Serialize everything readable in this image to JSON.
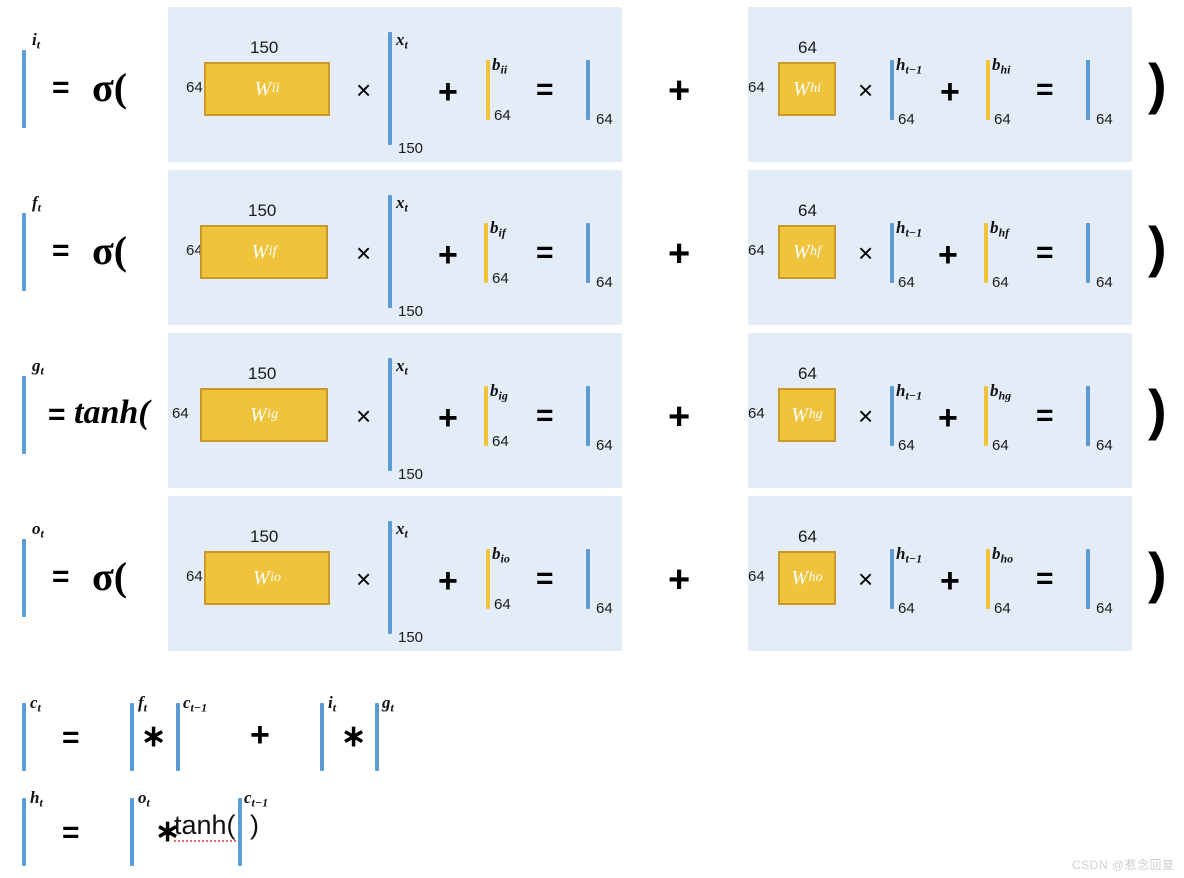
{
  "diagram": {
    "title": "LSTM gate equations with tensor shapes",
    "colors": {
      "panel_bg": "#e3ecf7",
      "weight_box_fill": "#f0c33c",
      "weight_box_border": "#c9992a",
      "vector_blue": "#5b9bd5",
      "bias_yellow": "#f2c238",
      "text": "#111111"
    }
  },
  "gate_rows": [
    {
      "output_var": "i",
      "output_sub": "t",
      "activation": "σ(",
      "activation_kind": "sigma",
      "input_dim_left": "64",
      "input_dim_top": "150",
      "weight_input": "W",
      "weight_input_sub": "ii",
      "vector_input": "x",
      "vector_input_sub": "t",
      "vector_input_dim": "150",
      "bias_input": "b",
      "bias_input_sub": "ii",
      "bias_input_dim": "64",
      "result_left_dim": "64",
      "hidden_dim_left": "64",
      "hidden_dim_top": "64",
      "weight_hidden": "W",
      "weight_hidden_sub": "hi",
      "vector_hidden": "h",
      "vector_hidden_sub": "t−1",
      "vector_hidden_dim": "64",
      "bias_hidden": "b",
      "bias_hidden_sub": "hi",
      "bias_hidden_dim": "64",
      "result_right_dim": "64"
    },
    {
      "output_var": "f",
      "output_sub": "t",
      "activation": "σ(",
      "activation_kind": "sigma",
      "input_dim_left": "64",
      "input_dim_top": "150",
      "weight_input": "W",
      "weight_input_sub": "if",
      "vector_input": "x",
      "vector_input_sub": "t",
      "vector_input_dim": "150",
      "bias_input": "b",
      "bias_input_sub": "if",
      "bias_input_dim": "64",
      "result_left_dim": "64",
      "hidden_dim_left": "64",
      "hidden_dim_top": "64",
      "weight_hidden": "W",
      "weight_hidden_sub": "hf",
      "vector_hidden": "h",
      "vector_hidden_sub": "t−1",
      "vector_hidden_dim": "64",
      "bias_hidden": "b",
      "bias_hidden_sub": "hf",
      "bias_hidden_dim": "64",
      "result_right_dim": "64"
    },
    {
      "output_var": "g",
      "output_sub": "t",
      "activation": "tanh(",
      "activation_kind": "tanh",
      "input_dim_left": "64",
      "input_dim_top": "150",
      "weight_input": "W",
      "weight_input_sub": "ig",
      "vector_input": "x",
      "vector_input_sub": "t",
      "vector_input_dim": "150",
      "bias_input": "b",
      "bias_input_sub": "ig",
      "bias_input_dim": "64",
      "result_left_dim": "64",
      "hidden_dim_left": "64",
      "hidden_dim_top": "64",
      "weight_hidden": "W",
      "weight_hidden_sub": "hg",
      "vector_hidden": "h",
      "vector_hidden_sub": "t−1",
      "vector_hidden_dim": "64",
      "bias_hidden": "b",
      "bias_hidden_sub": "hg",
      "bias_hidden_dim": "64",
      "result_right_dim": "64"
    },
    {
      "output_var": "o",
      "output_sub": "t",
      "activation": "σ(",
      "activation_kind": "sigma",
      "input_dim_left": "64",
      "input_dim_top": "150",
      "weight_input": "W",
      "weight_input_sub": "io",
      "vector_input": "x",
      "vector_input_sub": "t",
      "vector_input_dim": "150",
      "bias_input": "b",
      "bias_input_sub": "io",
      "bias_input_dim": "64",
      "result_left_dim": "64",
      "hidden_dim_left": "64",
      "hidden_dim_top": "64",
      "weight_hidden": "W",
      "weight_hidden_sub": "ho",
      "vector_hidden": "h",
      "vector_hidden_sub": "t−1",
      "vector_hidden_dim": "64",
      "bias_hidden": "b",
      "bias_hidden_sub": "ho",
      "bias_hidden_dim": "64",
      "result_right_dim": "64"
    }
  ],
  "operators": {
    "times": "×",
    "plus": "+",
    "equals": "=",
    "star": "∗",
    "close_paren": ")",
    "open_paren": "("
  },
  "cell_state_row": {
    "output_var": "c",
    "output_sub": "t",
    "equals": "=",
    "term1_var": "f",
    "term1_sub": "t",
    "star1": "∗",
    "term2_var": "c",
    "term2_sub": "t−1",
    "plus": "+",
    "term3_var": "i",
    "term3_sub": "t",
    "star2": "∗",
    "term4_var": "g",
    "term4_sub": "t"
  },
  "hidden_state_row": {
    "output_var": "h",
    "output_sub": "t",
    "equals": "=",
    "term1_var": "o",
    "term1_sub": "t",
    "star": "∗",
    "tanh_open": "tanh(",
    "term2_var": "c",
    "term2_sub": "t−1",
    "close_paren": ")"
  },
  "watermark": {
    "text": "CSDN @惹念回复"
  }
}
